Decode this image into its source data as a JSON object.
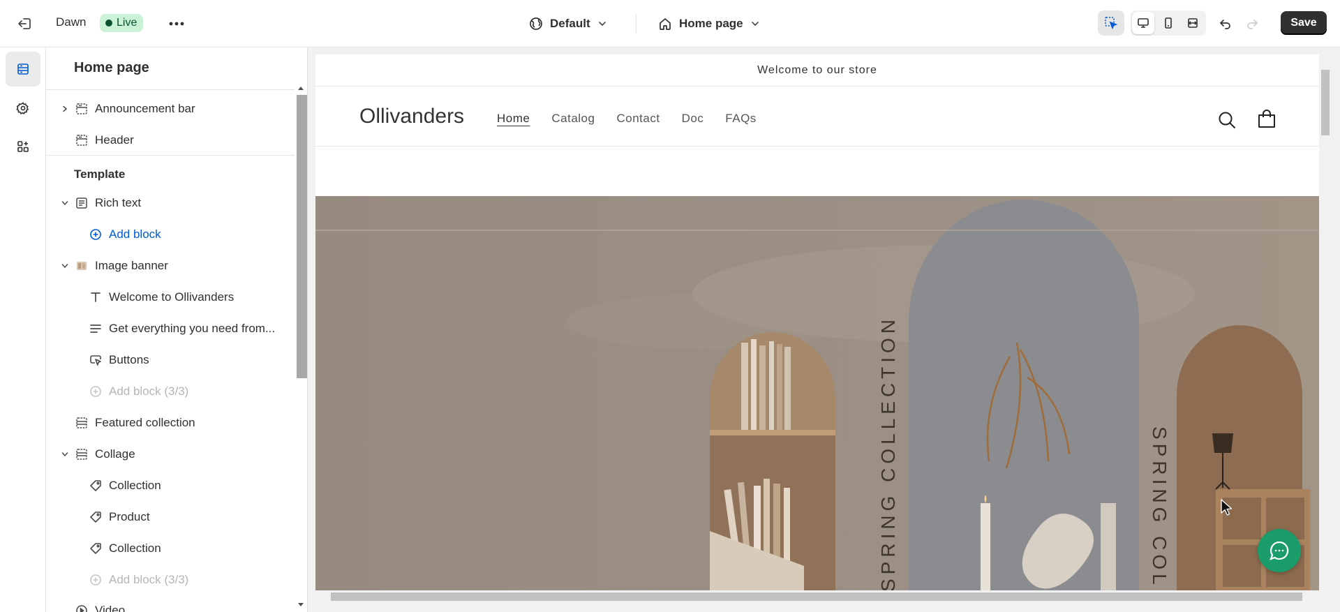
{
  "topbar": {
    "store_name": "Dawn",
    "status_badge": "Live",
    "theme_selector": "Default",
    "page_selector": "Home page",
    "save_label": "Save"
  },
  "sidebar": {
    "title": "Home page",
    "header_items": [
      {
        "label": "Announcement bar",
        "icon": "section-icon",
        "expandable": true
      },
      {
        "label": "Header",
        "icon": "section-icon",
        "expandable": false
      }
    ],
    "template_label": "Template",
    "template_items": [
      {
        "label": "Rich text",
        "icon": "rich-text-icon",
        "level": 1,
        "expanded": true
      },
      {
        "label": "Add block",
        "icon": "plus-circle-icon",
        "level": 2,
        "style": "link"
      },
      {
        "label": "Image banner",
        "icon": "image-banner-icon",
        "level": 1,
        "expanded": true
      },
      {
        "label": "Welcome to Ollivanders",
        "icon": "text-heading-icon",
        "level": 2
      },
      {
        "label": "Get everything you need from...",
        "icon": "text-paragraph-icon",
        "level": 2
      },
      {
        "label": "Buttons",
        "icon": "button-cursor-icon",
        "level": 2
      },
      {
        "label": "Add block (3/3)",
        "icon": "plus-circle-icon",
        "level": 2,
        "style": "muted"
      },
      {
        "label": "Featured collection",
        "icon": "section-icon",
        "level": 1
      },
      {
        "label": "Collage",
        "icon": "section-icon",
        "level": 1,
        "expanded": true
      },
      {
        "label": "Collection",
        "icon": "tag-icon",
        "level": 2
      },
      {
        "label": "Product",
        "icon": "tag-icon",
        "level": 2
      },
      {
        "label": "Collection",
        "icon": "tag-icon",
        "level": 2
      },
      {
        "label": "Add block (3/3)",
        "icon": "plus-circle-icon",
        "level": 2,
        "style": "muted"
      },
      {
        "label": "Video",
        "icon": "video-icon",
        "level": 1
      }
    ]
  },
  "preview": {
    "announcement": "Welcome to our store",
    "brand": "Ollivanders",
    "nav": [
      {
        "label": "Home",
        "active": true
      },
      {
        "label": "Catalog",
        "active": false
      },
      {
        "label": "Contact",
        "active": false
      },
      {
        "label": "Doc",
        "active": false
      },
      {
        "label": "FAQs",
        "active": false
      }
    ],
    "banner": {
      "left_arch_text": "SPRING COLLECTION",
      "right_arch_text": "SPRING COLLECTION"
    }
  },
  "colors": {
    "accent_link": "#005bd3",
    "live_badge_bg": "#c9f2d6",
    "save_bg": "#303030",
    "chat_button": "#1a9c6b"
  }
}
